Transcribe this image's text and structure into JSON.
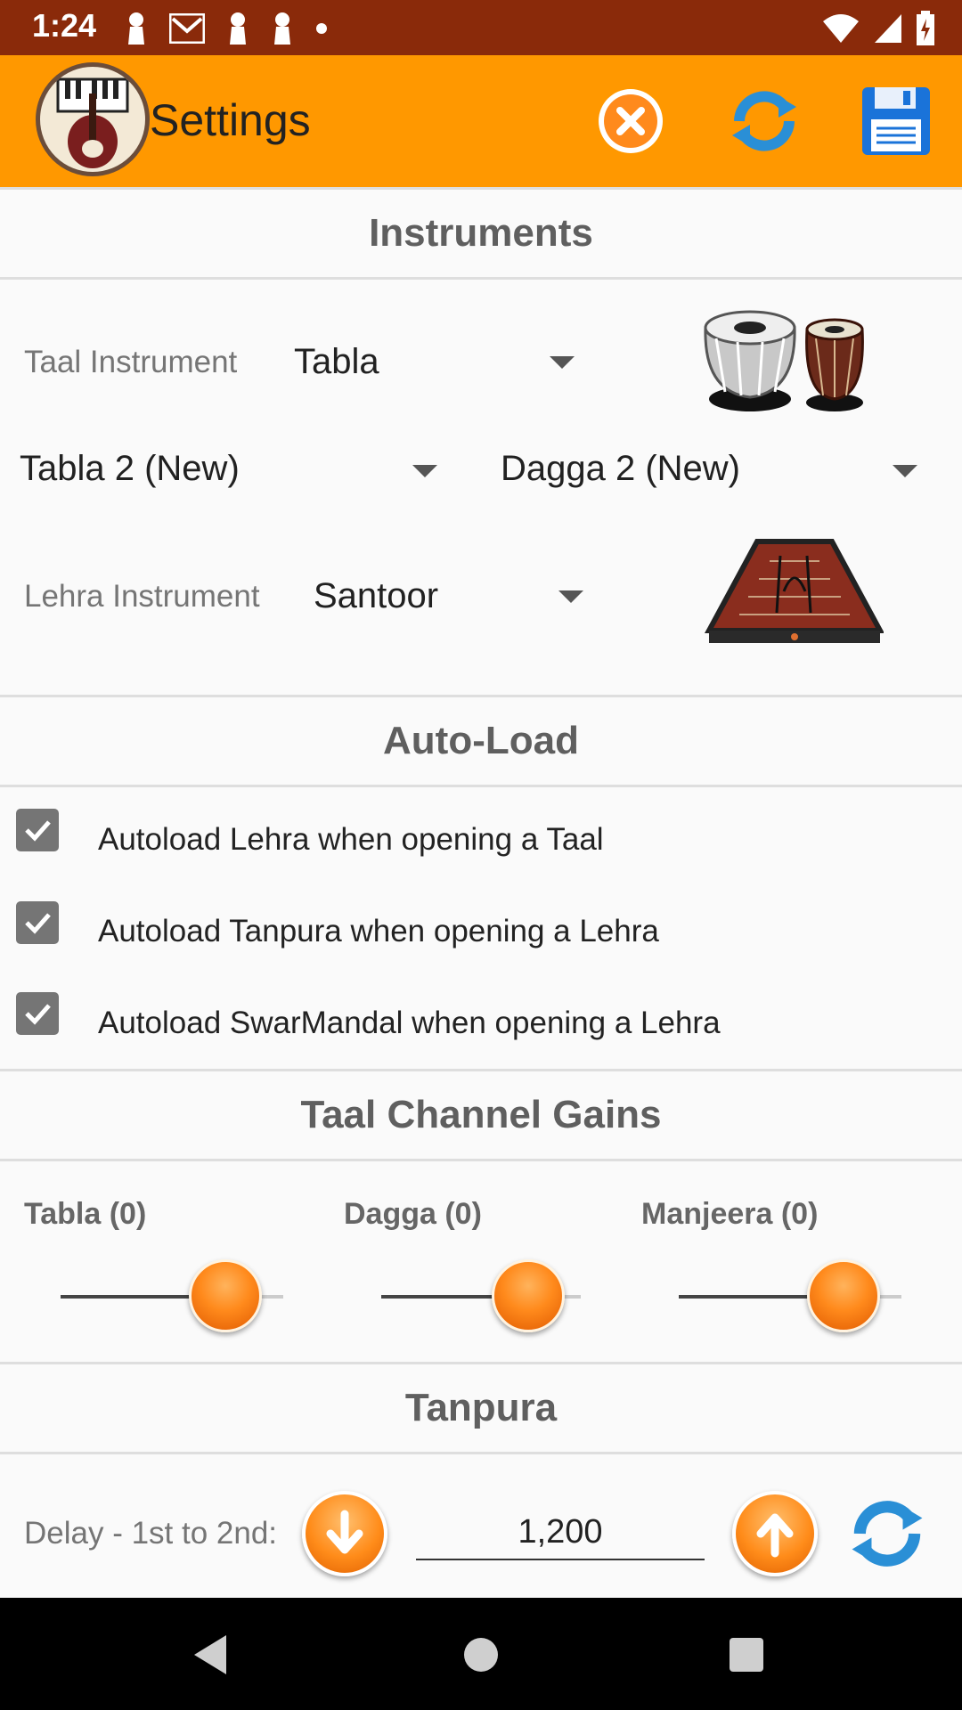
{
  "status_bar": {
    "time": "1:24"
  },
  "app_bar": {
    "title": "Settings"
  },
  "sections": {
    "instruments": "Instruments",
    "auto_load": "Auto-Load",
    "taal_gains": "Taal Channel Gains",
    "tanpura": "Tanpura"
  },
  "instruments": {
    "taal_label": "Taal Instrument",
    "taal_value": "Tabla",
    "tabla_variant": "Tabla 2 (New)",
    "dagga_variant": "Dagga 2 (New)",
    "lehra_label": "Lehra Instrument",
    "lehra_value": "Santoor"
  },
  "autoload": [
    {
      "label": "Autoload Lehra when opening a Taal",
      "checked": true
    },
    {
      "label": "Autoload Tanpura when opening a Lehra",
      "checked": true
    },
    {
      "label": "Autoload SwarMandal when opening a Lehra",
      "checked": true
    }
  ],
  "gains": [
    {
      "label": "Tabla (0)",
      "value_fraction": 0.75
    },
    {
      "label": "Dagga (0)",
      "value_fraction": 0.75
    },
    {
      "label": "Manjeera (0)",
      "value_fraction": 0.75
    }
  ],
  "tanpura": {
    "delay_label": "Delay - 1st to 2nd:",
    "delay_value": "1,200"
  },
  "colors": {
    "status_bar": "#8a2a0a",
    "app_bar": "#ff9800",
    "accent": "#ff8a1c"
  }
}
